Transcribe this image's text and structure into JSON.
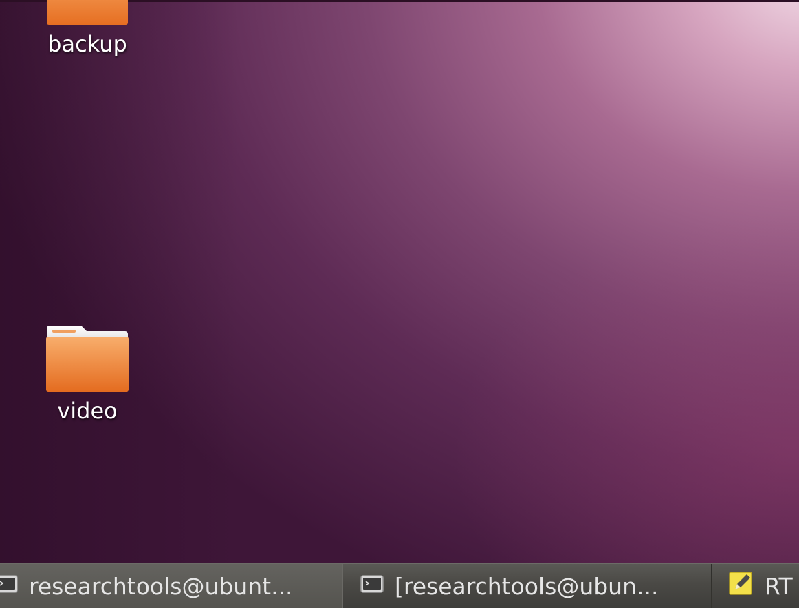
{
  "desktop": {
    "icons": [
      {
        "label": "backup",
        "icon": "folder-icon"
      },
      {
        "label": "video",
        "icon": "folder-icon"
      }
    ],
    "colors": {
      "wallpaper_light": "#f3dde8",
      "wallpaper_mid": "#7e4670",
      "wallpaper_dark": "#3e1638",
      "folder_orange": "#f08a3c"
    }
  },
  "taskbar": {
    "tasks": [
      {
        "label": "researchtools@ubunt...",
        "icon": "terminal-icon"
      },
      {
        "label": "[researchtools@ubun...",
        "icon": "terminal-icon"
      },
      {
        "label": "RT",
        "icon": "text-editor-icon"
      }
    ]
  }
}
